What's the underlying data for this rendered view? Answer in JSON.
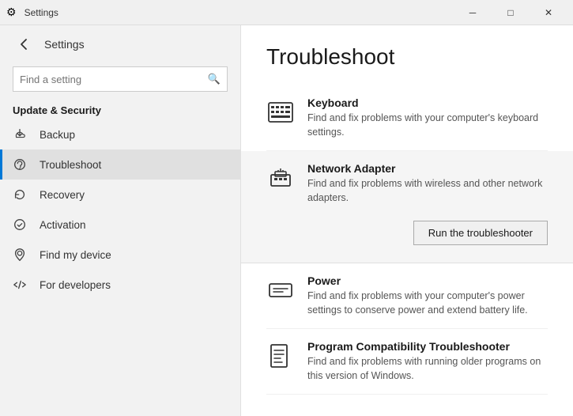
{
  "titlebar": {
    "title": "Settings",
    "minimize_label": "─",
    "maximize_label": "□",
    "close_label": "✕"
  },
  "sidebar": {
    "back_title": "Settings",
    "search_placeholder": "Find a setting",
    "section_label": "Update & Security",
    "nav_items": [
      {
        "id": "backup",
        "label": "Backup",
        "icon": "backup"
      },
      {
        "id": "troubleshoot",
        "label": "Troubleshoot",
        "icon": "troubleshoot",
        "active": true
      },
      {
        "id": "recovery",
        "label": "Recovery",
        "icon": "recovery"
      },
      {
        "id": "activation",
        "label": "Activation",
        "icon": "activation"
      },
      {
        "id": "find-my-device",
        "label": "Find my device",
        "icon": "find"
      },
      {
        "id": "for-developers",
        "label": "For developers",
        "icon": "developers"
      }
    ]
  },
  "content": {
    "title": "Troubleshoot",
    "items": [
      {
        "id": "keyboard",
        "title": "Keyboard",
        "description": "Find and fix problems with your computer's keyboard settings.",
        "icon": "keyboard",
        "highlighted": false
      },
      {
        "id": "network-adapter",
        "title": "Network Adapter",
        "description": "Find and fix problems with wireless and other network adapters.",
        "icon": "network",
        "highlighted": true,
        "run_button": "Run the troubleshooter"
      },
      {
        "id": "power",
        "title": "Power",
        "description": "Find and fix problems with your computer's power settings to conserve power and extend battery life.",
        "icon": "power",
        "highlighted": false
      },
      {
        "id": "program-compat",
        "title": "Program Compatibility Troubleshooter",
        "description": "Find and fix problems with running older programs on this version of Windows.",
        "icon": "program",
        "highlighted": false
      }
    ]
  }
}
